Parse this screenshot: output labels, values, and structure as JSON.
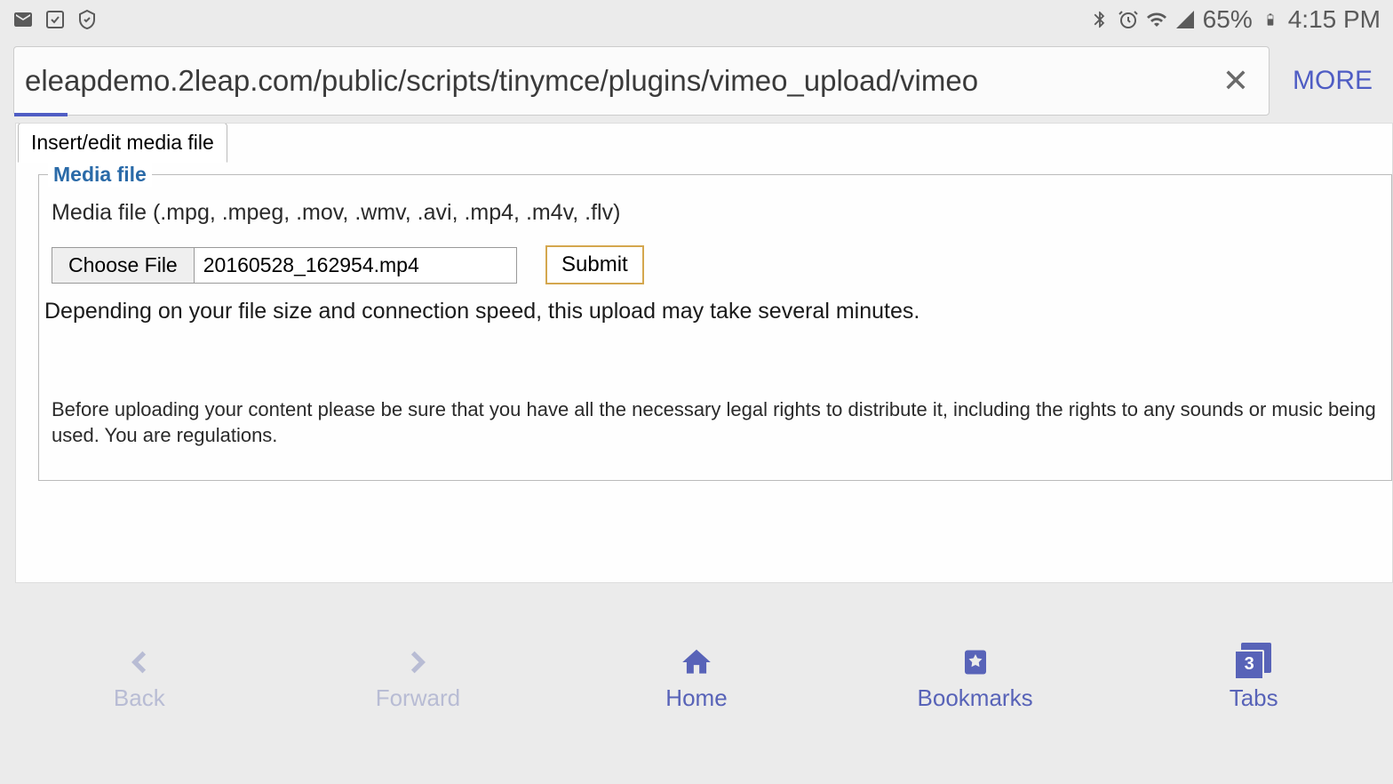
{
  "status": {
    "battery": "65%",
    "time": "4:15 PM"
  },
  "browser": {
    "url": "eleapdemo.2leap.com/public/scripts/tinymce/plugins/vimeo_upload/vimeo",
    "more_label": "MORE"
  },
  "dialog": {
    "tab_label": "Insert/edit media file",
    "legend": "Media file",
    "file_types_label": "Media file (.mpg, .mpeg, .mov, .wmv, .avi, .mp4, .m4v, .flv)",
    "choose_file_label": "Choose File",
    "selected_file": "20160528_162954.mp4",
    "submit_label": "Submit",
    "upload_info": "Depending on your file size and connection speed, this upload may take several minutes.",
    "legal_notice": "Before uploading your content please be sure that you have all the necessary legal rights to distribute it, including the rights to any sounds or music being used. You are regulations."
  },
  "nav": {
    "back": "Back",
    "forward": "Forward",
    "home": "Home",
    "bookmarks": "Bookmarks",
    "tabs": "Tabs",
    "tab_count": "3"
  }
}
